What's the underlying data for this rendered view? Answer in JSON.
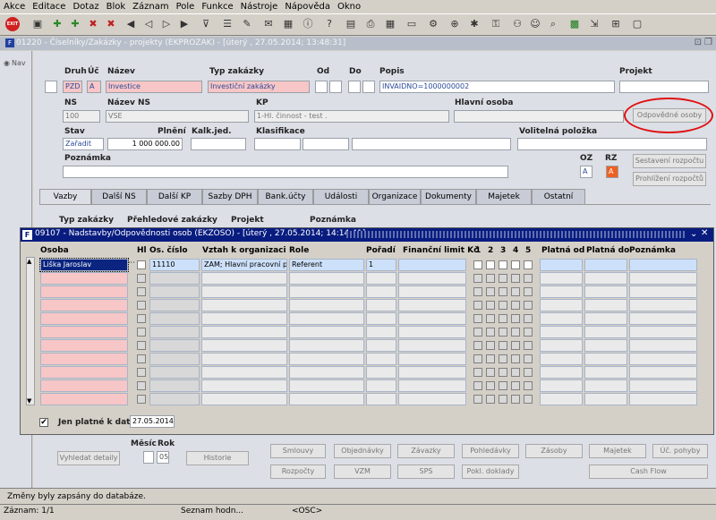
{
  "menu": [
    "Akce",
    "Editace",
    "Dotaz",
    "Blok",
    "Záznam",
    "Pole",
    "Funkce",
    "Nástroje",
    "Nápověda",
    "Okno"
  ],
  "toolbar": {
    "exit_label": "EXIT"
  },
  "window": {
    "title": "01220 - Číselníky/Zakázky - projekty (EKPROZAK) - [úterý  , 27.05.2014; 13:48:31]"
  },
  "nav": {
    "label": "Nav"
  },
  "form": {
    "labels": {
      "druh": "Druh",
      "uc": "Úč",
      "nazev": "Název",
      "typ": "Typ zakázky",
      "od": "Od",
      "do": "Do",
      "popis": "Popis",
      "projekt": "Projekt",
      "ns": "NS",
      "nazev_ns": "Název NS",
      "kp": "KP",
      "hlavni": "Hlavní osoba",
      "stav": "Stav",
      "plneni": "Plnění",
      "kalk": "Kalk.jed.",
      "klasif": "Klasifikace",
      "volitelna": "Volitelná položka",
      "poznamka": "Poznámka",
      "oz": "OZ",
      "rz": "RZ"
    },
    "values": {
      "druh": "PZD",
      "uc": "A",
      "nazev": "Investice",
      "typ": "Investiční zakázky",
      "popis": "INVAIDNO=1000000002",
      "ns": "100",
      "nazev_ns": "VSE",
      "kp": "1-Hl. činnost - test .",
      "stav": "Zařadit",
      "plneni": "1 000 000.00",
      "oz": "A",
      "rz": "A"
    },
    "buttons": {
      "odpovedne": "Odpovědné osoby",
      "sestaveni": "Sestavení rozpočtu",
      "prohlizeni": "Prohlížení rozpočtů"
    }
  },
  "tabs": [
    "Vazby",
    "Další NS",
    "Další KP",
    "Sazby DPH",
    "Bank.účty",
    "Události",
    "Organizace",
    "Dokumenty",
    "Majetek",
    "Ostatní"
  ],
  "vazby_headers": {
    "typ": "Typ zakázky",
    "prehled": "Přehledové zakázky",
    "projekt": "Projekt",
    "poznamka": "Poznámka"
  },
  "dialog": {
    "title": "09107 - Nadstavby/Odpovědnosti osob (EKZOSO) - [úterý  , 27.05.2014; 14:14:41]",
    "headers": {
      "osoba": "Osoba",
      "hl": "Hl",
      "os_cislo": "Os. číslo",
      "vztah": "Vztah k organizaci",
      "role": "Role",
      "poradi": "Pořadí",
      "limit": "Finanční limit Kč",
      "c1": "1",
      "c2": "2",
      "c3": "3",
      "c4": "4",
      "c5": "5",
      "platna_od": "Platná od",
      "platna_do": "Platná do",
      "poznamka": "Poznámka"
    },
    "row1": {
      "osoba": "Liška Jaroslav",
      "os_cislo": "11110",
      "vztah": "ZAM; Hlavní pracovní poměr",
      "role": "Referent",
      "poradi": "1"
    },
    "jen_platne_label": "Jen platné k datu",
    "jen_platne_date": "27.05.2014"
  },
  "bottom": {
    "mesic": "Měsíc",
    "rok": "Rok",
    "rok_value": "05",
    "vyhledat": "Vyhledat detaily",
    "historie": "Historie",
    "buttons_row1": [
      "Smlouvy",
      "Objednávky",
      "Závazky",
      "Pohledávky",
      "Zásoby",
      "Majetek",
      "Úč. pohyby"
    ],
    "buttons_row2": [
      "Rozpočty",
      "VZM",
      "SPS",
      "Pokl. doklady",
      "Cash Flow"
    ]
  },
  "status": {
    "message": "Změny byly zapsány do databáze.",
    "zaznam": "Záznam: 1/1",
    "seznam": "Seznam hodn...",
    "osc": "<OSC>"
  }
}
